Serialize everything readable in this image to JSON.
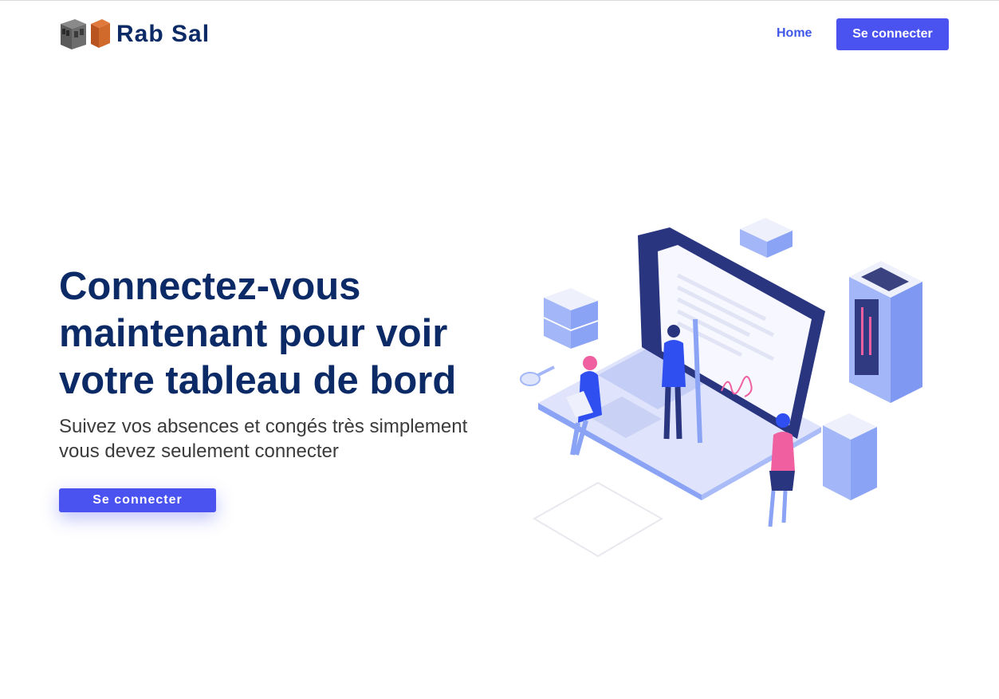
{
  "header": {
    "brand_name": "Rab Sal",
    "nav_home": "Home",
    "nav_login": "Se connecter"
  },
  "hero": {
    "title": "Connectez-vous maintenant pour voir votre tableau de bord",
    "subtitle": "Suivez vos absences et congés très simplement vous devez seulement connecter",
    "cta": "Se connecter"
  },
  "icons": {
    "logo": "building-blocks-logo",
    "illustration": "laptop-signature-illustration"
  },
  "colors": {
    "brand_text": "#0b2a66",
    "accent": "#4a52ef",
    "nav_link": "#3f57e8",
    "illustration_pink": "#f05fa0",
    "illustration_blue": "#2f4ff0"
  }
}
